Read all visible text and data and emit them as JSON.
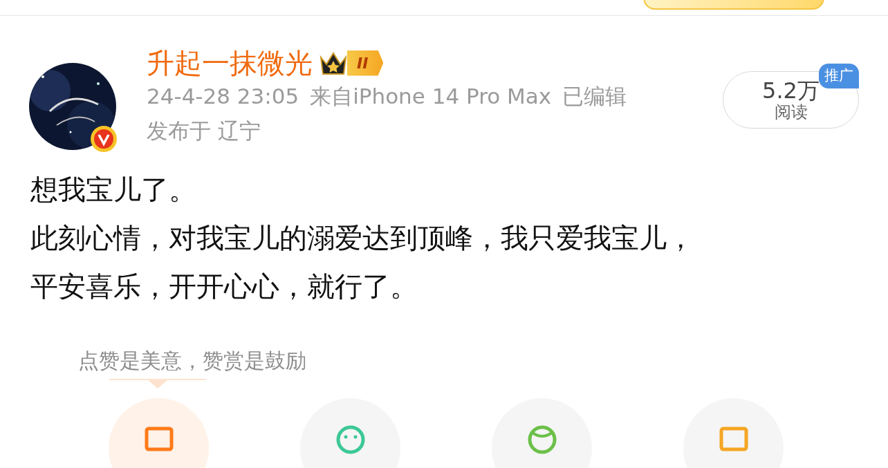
{
  "author": {
    "name": "升起一抹微光",
    "level_badge": "II",
    "time": "24-4-28 23:05",
    "source": "来自iPhone 14 Pro Max",
    "edited": "已编辑",
    "location": "发布于 辽宁"
  },
  "reads": {
    "count": "5.2万",
    "label": "阅读",
    "promo_tag": "推广"
  },
  "post": {
    "lines": [
      "想我宝儿了。",
      "此刻心情，对我宝儿的溺爱达到顶峰，我只爱我宝儿，",
      "平安喜乐，开开心心，就行了。"
    ]
  },
  "reward_hint": "点赞是美意，赞赏是鼓励",
  "actions": [
    {
      "kind": "reward",
      "color": "#ff7a1a"
    },
    {
      "kind": "smile",
      "color": "#3cc896"
    },
    {
      "kind": "ball",
      "color": "#6cc04a"
    },
    {
      "kind": "card",
      "color": "#f5a623"
    }
  ]
}
